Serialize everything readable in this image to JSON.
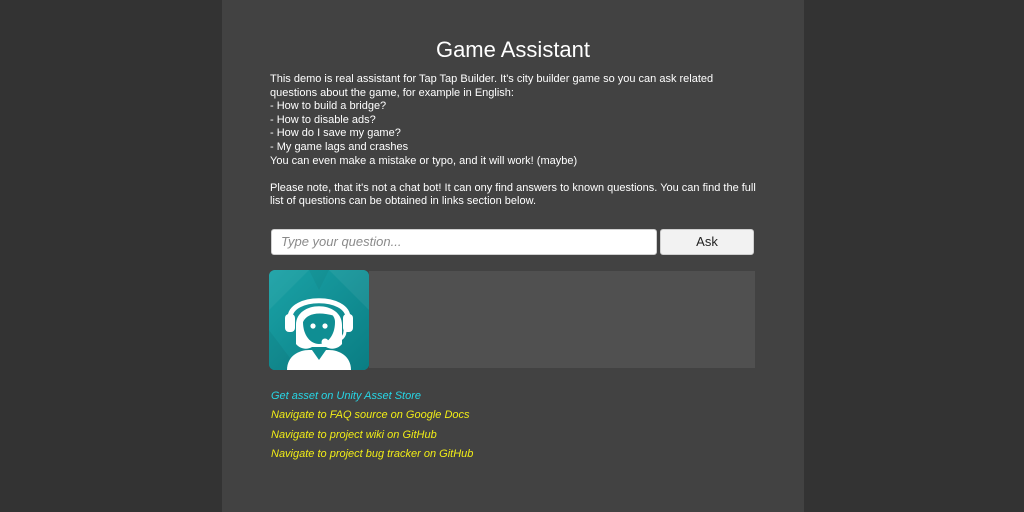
{
  "title": "Game Assistant",
  "description": {
    "lines": [
      "This demo is real assistant for Tap Tap Builder. It's city builder game so you can ask related",
      "questions about the game, for example in English:",
      "- How to build a bridge?",
      "- How to disable ads?",
      "- How do I save my game?",
      "- My game lags and crashes",
      "You can even make a mistake or typo, and it will work! (maybe)"
    ],
    "note": "Please note, that it's not a chat bot! It can ony find answers to known questions. You can find the full list of questions can be obtained in links section below."
  },
  "question_input": {
    "placeholder": "Type your question...",
    "value": ""
  },
  "ask_button": "Ask",
  "avatar_icon": "support-agent-headset-icon",
  "answer": "",
  "links": [
    {
      "label": "Get asset on Unity Asset Store",
      "color": "#27d6e6"
    },
    {
      "label": "Navigate to FAQ source on Google Docs",
      "color": "#f1ed16"
    },
    {
      "label": "Navigate to project wiki on GitHub",
      "color": "#f1ed16"
    },
    {
      "label": "Navigate to project bug tracker on GitHub",
      "color": "#f1ed16"
    }
  ],
  "colors": {
    "background": "#333333",
    "panel": "#424242",
    "answer_box": "#505050",
    "avatar_bg": "#0f8e93"
  }
}
